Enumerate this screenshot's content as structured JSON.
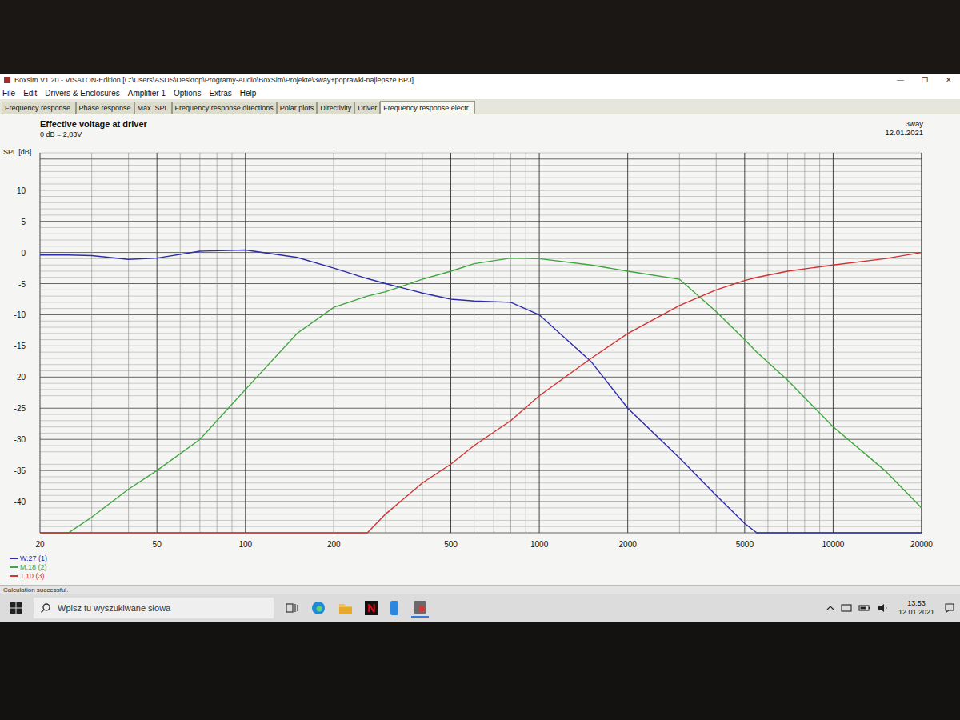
{
  "window": {
    "title": "Boxsim V1.20 - VISATON-Edition [C:\\Users\\ASUS\\Desktop\\Programy-Audio\\BoxSim\\Projekte\\3way+poprawki-najlepsze.BPJ]",
    "controls": [
      "—",
      "❐",
      "✕"
    ]
  },
  "menu": [
    "File",
    "Edit",
    "Drivers & Enclosures",
    "Amplifier 1",
    "Options",
    "Extras",
    "Help"
  ],
  "tabs": [
    {
      "label": "Frequency response.",
      "selected": false
    },
    {
      "label": "Phase response",
      "selected": false
    },
    {
      "label": "Max. SPL",
      "selected": false
    },
    {
      "label": "Frequency response directions",
      "selected": false
    },
    {
      "label": "Polar plots",
      "selected": false
    },
    {
      "label": "Directivity",
      "selected": false
    },
    {
      "label": "Driver",
      "selected": false
    },
    {
      "label": "Frequency response electr..",
      "selected": true
    }
  ],
  "chart": {
    "title": "Effective voltage at driver",
    "subtitle": "0 dB = 2,83V",
    "project": "3way",
    "date": "12.01.2021",
    "y_axis_label": "SPL [dB]",
    "y_ticks": [
      {
        "label": "10",
        "value": 10
      },
      {
        "label": "5",
        "value": 5
      },
      {
        "label": "0",
        "value": 0
      },
      {
        "label": "-5",
        "value": -5
      },
      {
        "label": "-10",
        "value": -10
      },
      {
        "label": "-15",
        "value": -15
      },
      {
        "label": "-20",
        "value": -20
      },
      {
        "label": "-25",
        "value": -25
      },
      {
        "label": "-30",
        "value": -30
      },
      {
        "label": "-35",
        "value": -35
      },
      {
        "label": "-40",
        "value": -40
      }
    ],
    "x_ticks": [
      {
        "label": "20",
        "value": 20
      },
      {
        "label": "50",
        "value": 50
      },
      {
        "label": "100",
        "value": 100
      },
      {
        "label": "200",
        "value": 200
      },
      {
        "label": "500",
        "value": 500
      },
      {
        "label": "1000",
        "value": 1000
      },
      {
        "label": "2000",
        "value": 2000
      },
      {
        "label": "5000",
        "value": 5000
      },
      {
        "label": "10000",
        "value": 10000
      },
      {
        "label": "20000",
        "value": 20000
      }
    ],
    "frequencies": [
      20,
      25,
      30,
      40,
      50,
      70,
      100,
      150,
      200,
      260,
      300,
      400,
      500,
      600,
      800,
      1000,
      1500,
      2000,
      3000,
      4000,
      5000,
      5500,
      7000,
      10000,
      15000,
      20000
    ],
    "series": [
      {
        "name": "W.27 (1)",
        "color": "#2c2caa",
        "values": [
          -0.4,
          -0.4,
          -0.5,
          -1.1,
          -0.9,
          0.2,
          0.4,
          -0.8,
          -2.5,
          -4.2,
          -5,
          -6.5,
          -7.5,
          -7.8,
          -8,
          -10,
          -17.5,
          -25,
          -33,
          -39,
          -43.5,
          -45,
          -45,
          -45,
          -45,
          -45
        ]
      },
      {
        "name": "M.18 (2)",
        "color": "#3fa53f",
        "values": [
          -45,
          -45,
          -42.5,
          -38,
          -35,
          -30,
          -22,
          -13,
          -8.8,
          -7,
          -6.3,
          -4.3,
          -3,
          -1.8,
          -0.9,
          -1,
          -2,
          -3,
          -4.3,
          -9.5,
          -14,
          -16,
          -20.5,
          -28,
          -35,
          -41
        ]
      },
      {
        "name": "T.10 (3)",
        "color": "#d23232",
        "values": [
          -45,
          -45,
          -45,
          -45,
          -45,
          -45,
          -45,
          -45,
          -45,
          -45,
          -42,
          -37,
          -34,
          -31,
          -27,
          -23,
          -17,
          -13,
          -8.5,
          -6,
          -4.5,
          -4,
          -3,
          -2,
          -1,
          0
        ]
      }
    ]
  },
  "status_bar": "Calculation successful.",
  "taskbar": {
    "search_placeholder": "Wpisz tu wyszukiwane słowa",
    "netflix_glyph": "N",
    "time": "13:53",
    "date": "12.01.2021"
  }
}
